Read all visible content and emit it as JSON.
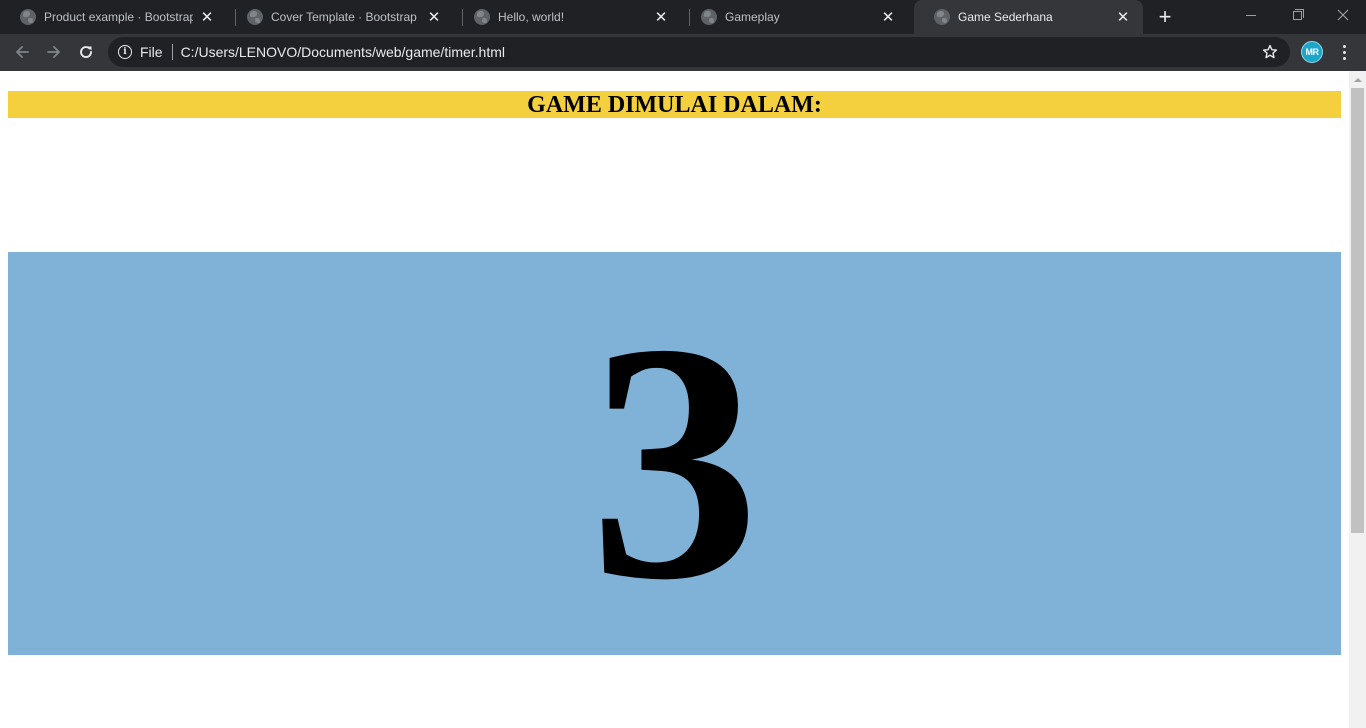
{
  "browser": {
    "tabs": [
      {
        "title": "Product example · Bootstrap",
        "active": false
      },
      {
        "title": "Cover Template · Bootstrap",
        "active": false
      },
      {
        "title": "Hello, world!",
        "active": false
      },
      {
        "title": "Gameplay",
        "active": false
      },
      {
        "title": "Game Sederhana",
        "active": true
      }
    ],
    "new_tab_label": "+",
    "close_label": "✕",
    "address_bar": {
      "scheme_label": "File",
      "url": "C:/Users/LENOVO/Documents/web/game/timer.html"
    },
    "profile_initials": "MR",
    "icons": {
      "back": "back-arrow-icon",
      "forward": "forward-arrow-icon",
      "reload": "reload-icon",
      "info": "info-icon",
      "bookmark": "star-icon",
      "menu": "more-vert-icon"
    },
    "colors": {
      "tabstrip": "#202124",
      "toolbar": "#35363a",
      "omnibox": "#202124",
      "avatar": "#1ea6c8"
    }
  },
  "page": {
    "heading": "GAME DIMULAI DALAM:",
    "countdown": "3",
    "colors": {
      "heading_background": "#f4d03f",
      "countdown_background": "#7fb2d6",
      "text": "#000000"
    }
  }
}
